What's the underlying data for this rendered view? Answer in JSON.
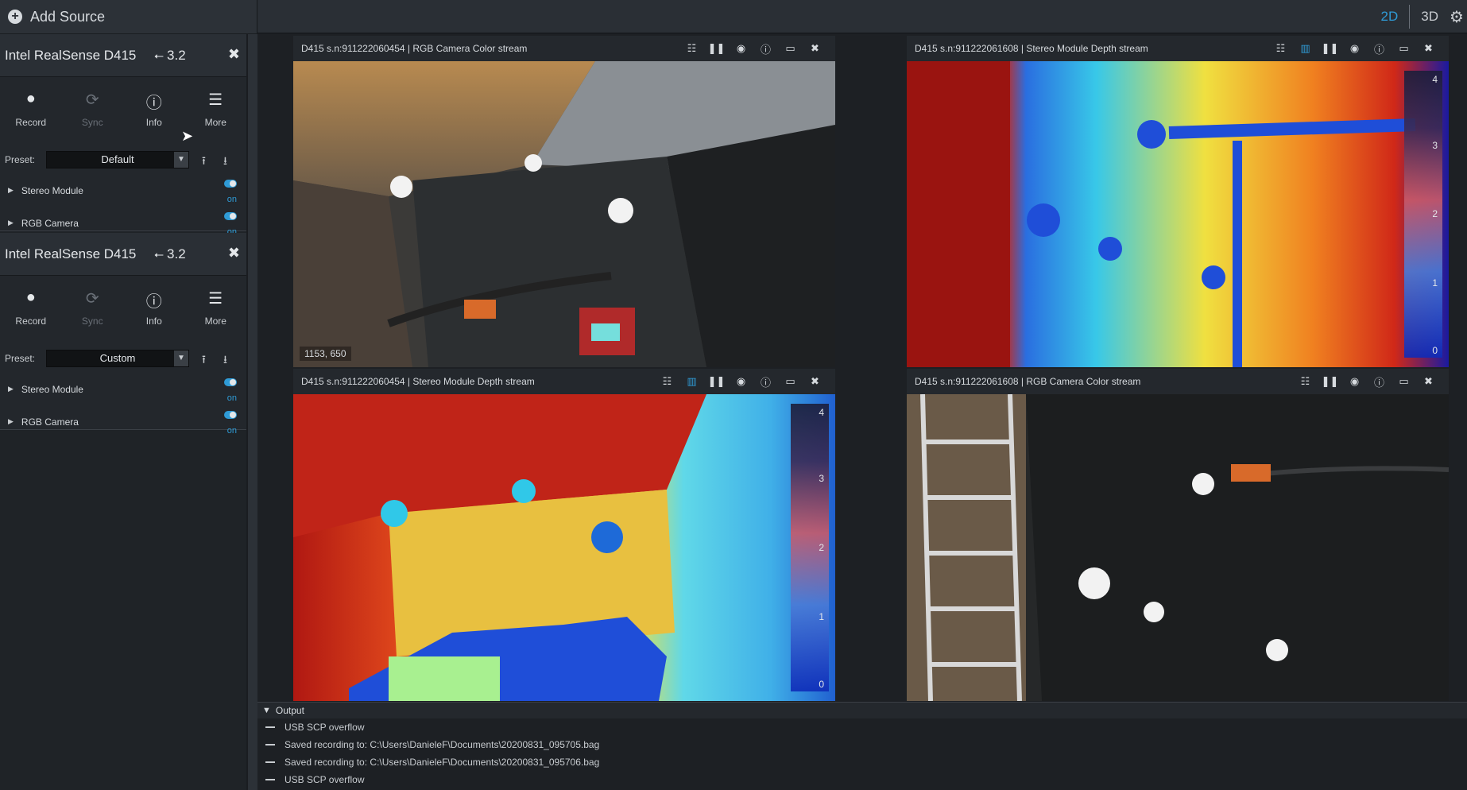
{
  "topbar": {
    "add_source_label": "Add Source",
    "view_2d": "2D",
    "view_3d": "3D"
  },
  "devices": [
    {
      "name": "Intel RealSense D415",
      "usb": "3.2",
      "actions": [
        "Record",
        "Sync",
        "Info",
        "More"
      ],
      "preset_label": "Preset:",
      "preset_value": "Default",
      "sensors": [
        {
          "name": "Stereo Module",
          "state": "on"
        },
        {
          "name": "RGB Camera",
          "state": "on"
        }
      ]
    },
    {
      "name": "Intel RealSense D415",
      "usb": "3.2",
      "actions": [
        "Record",
        "Sync",
        "Info",
        "More"
      ],
      "preset_label": "Preset:",
      "preset_value": "Custom",
      "sensors": [
        {
          "name": "Stereo Module",
          "state": "on"
        },
        {
          "name": "RGB Camera",
          "state": "on"
        }
      ]
    }
  ],
  "streams": [
    {
      "title": "D415 s.n:911222060454 | RGB Camera Color stream",
      "coord": "1153, 650"
    },
    {
      "title": "D415 s.n:911222061608 | Stereo Module Depth stream",
      "colorbar": [
        "4",
        "3",
        "2",
        "1",
        "0"
      ]
    },
    {
      "title": "D415 s.n:911222060454 | Stereo Module Depth stream",
      "colorbar": [
        "4",
        "3",
        "2",
        "1",
        "0"
      ]
    },
    {
      "title": "D415 s.n:911222061608 | RGB Camera Color stream"
    }
  ],
  "output": {
    "title": "Output",
    "lines": [
      "USB SCP overflow",
      "Saved recording to: C:\\Users\\DanieleF\\Documents\\20200831_095705.bag",
      "Saved recording to: C:\\Users\\DanieleF\\Documents\\20200831_095706.bag",
      "USB SCP overflow"
    ]
  },
  "colors": {
    "accent": "#2f9bd6",
    "panel": "#23272c",
    "background": "#1a1d21"
  }
}
